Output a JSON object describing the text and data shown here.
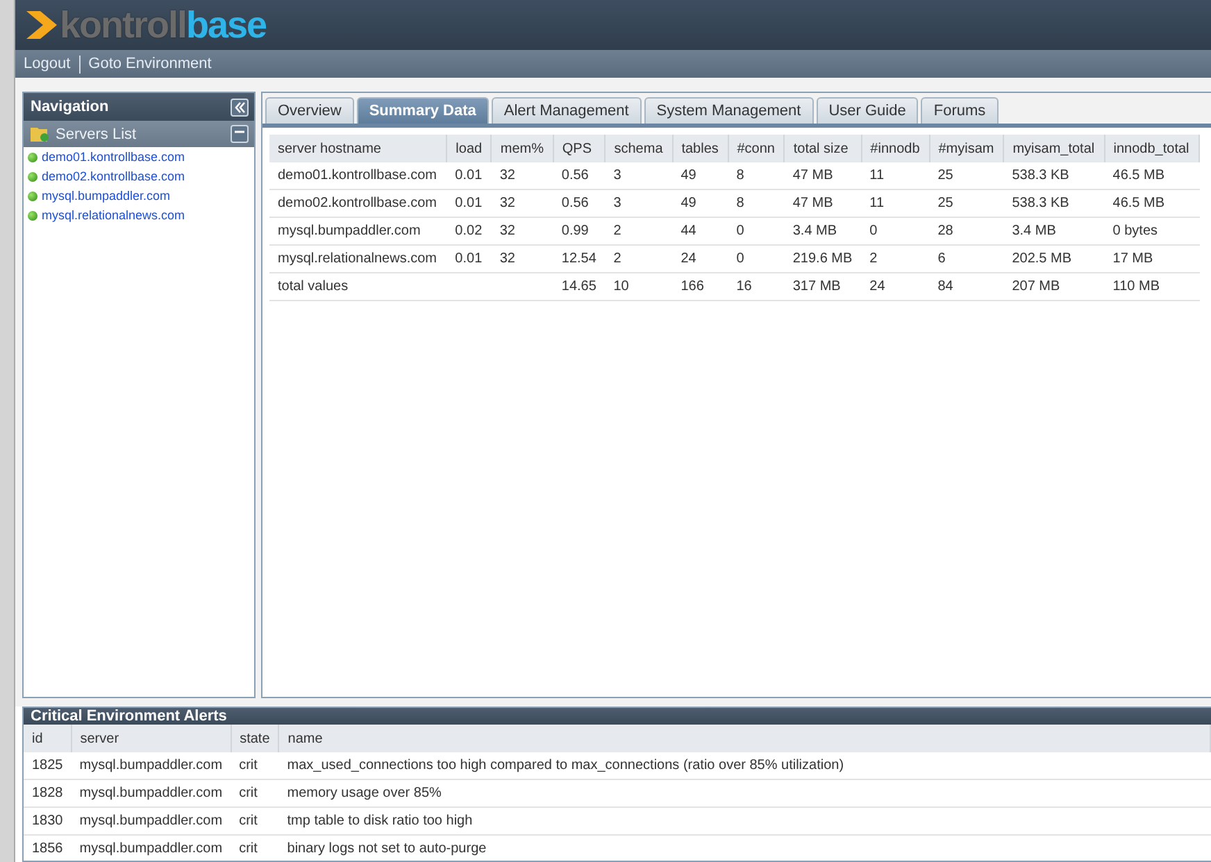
{
  "logo": {
    "prefix": "kontroll",
    "suffix": "base"
  },
  "top_links": [
    "Logout",
    "Goto Environment"
  ],
  "navigation": {
    "title": "Navigation",
    "section": "Servers List",
    "servers": [
      "demo01.kontrollbase.com",
      "demo02.kontrollbase.com",
      "mysql.bumpaddler.com",
      "mysql.relationalnews.com"
    ]
  },
  "tabs": [
    {
      "label": "Overview",
      "selected": false
    },
    {
      "label": "Summary Data",
      "selected": true
    },
    {
      "label": "Alert Management",
      "selected": false
    },
    {
      "label": "System Management",
      "selected": false
    },
    {
      "label": "User Guide",
      "selected": false
    },
    {
      "label": "Forums",
      "selected": false
    }
  ],
  "table": {
    "columns": [
      "server hostname",
      "load",
      "mem%",
      "QPS",
      "schema",
      "tables",
      "#conn",
      "total size",
      "#innodb",
      "#myisam",
      "myisam_total",
      "innodb_total"
    ],
    "rows": [
      [
        "demo01.kontrollbase.com",
        "0.01",
        "32",
        "0.56",
        "3",
        "49",
        "8",
        "47 MB",
        "11",
        "25",
        "538.3 KB",
        "46.5 MB"
      ],
      [
        "demo02.kontrollbase.com",
        "0.01",
        "32",
        "0.56",
        "3",
        "49",
        "8",
        "47 MB",
        "11",
        "25",
        "538.3 KB",
        "46.5 MB"
      ],
      [
        "mysql.bumpaddler.com",
        "0.02",
        "32",
        "0.99",
        "2",
        "44",
        "0",
        "3.4 MB",
        "0",
        "28",
        "3.4 MB",
        "0 bytes"
      ],
      [
        "mysql.relationalnews.com",
        "0.01",
        "32",
        "12.54",
        "2",
        "24",
        "0",
        "219.6 MB",
        "2",
        "6",
        "202.5 MB",
        "17 MB"
      ],
      [
        "total values",
        "",
        "",
        "14.65",
        "10",
        "166",
        "16",
        "317 MB",
        "24",
        "84",
        "207 MB",
        "110 MB"
      ]
    ]
  },
  "alerts": {
    "title": "Critical Environment Alerts",
    "columns": [
      "id",
      "server",
      "state",
      "name"
    ],
    "rows": [
      [
        "1825",
        "mysql.bumpaddler.com",
        "crit",
        "max_used_connections too high compared to max_connections (ratio over 85% utilization)"
      ],
      [
        "1828",
        "mysql.bumpaddler.com",
        "crit",
        "memory usage over 85%"
      ],
      [
        "1830",
        "mysql.bumpaddler.com",
        "crit",
        "tmp table to disk ratio too high"
      ],
      [
        "1856",
        "mysql.bumpaddler.com",
        "crit",
        "binary logs not set to auto-purge"
      ]
    ]
  }
}
